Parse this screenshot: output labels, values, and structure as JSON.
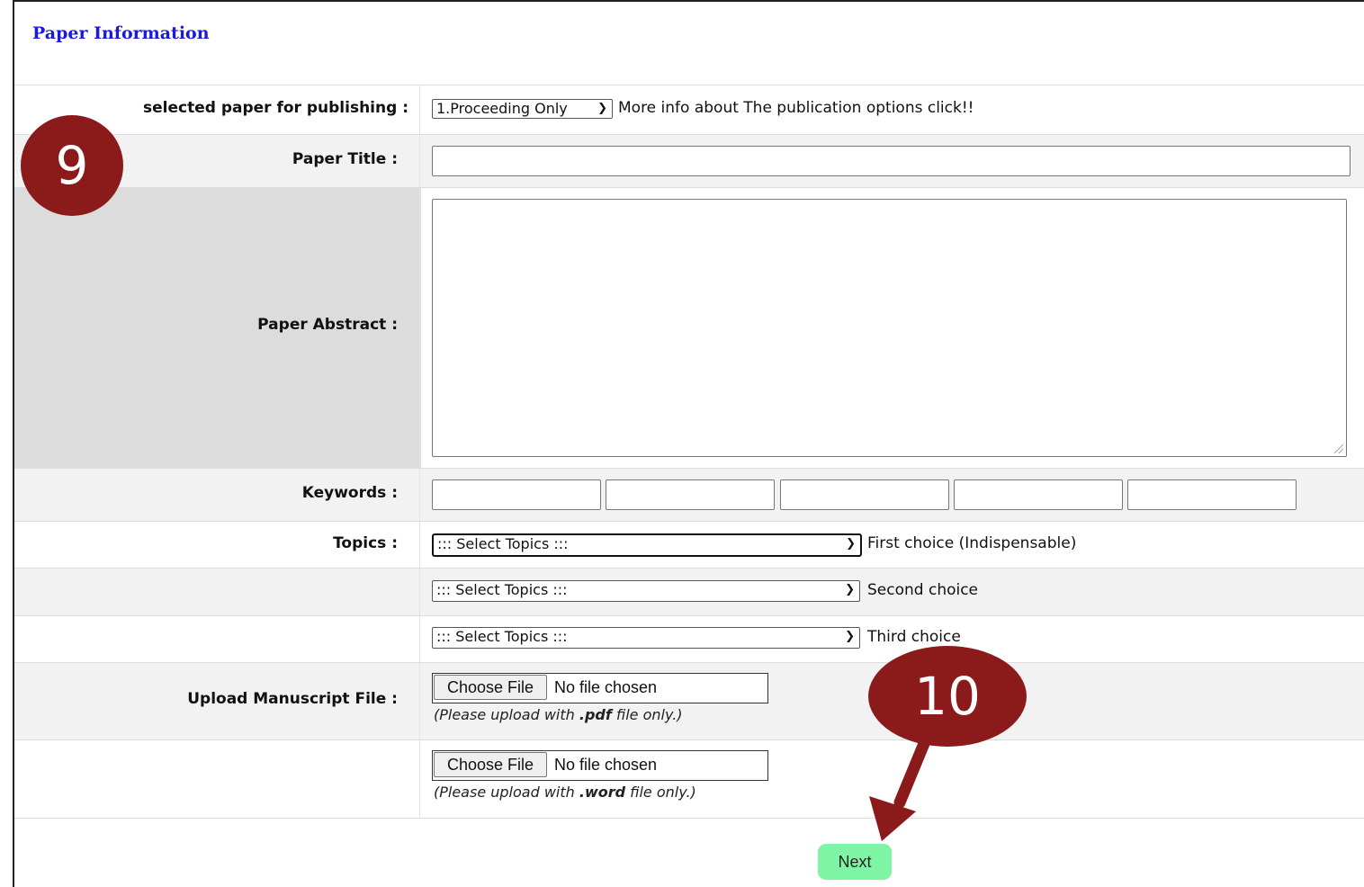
{
  "header": {
    "title": "Paper Information"
  },
  "form": {
    "publishing": {
      "label": "selected paper for publishing :",
      "selected": "1.Proceeding Only",
      "info_text": "More info about The publication options click!!"
    },
    "title": {
      "label": "Paper Title :",
      "value": ""
    },
    "abstract": {
      "label": "Paper Abstract :",
      "value": ""
    },
    "keywords": {
      "label": "Keywords :",
      "values": [
        "",
        "",
        "",
        "",
        ""
      ]
    },
    "topics": {
      "label": "Topics :",
      "choices": [
        {
          "selected": "::: Select Topics :::",
          "note": "First choice (Indispensable)"
        },
        {
          "selected": "::: Select Topics :::",
          "note": "Second choice"
        },
        {
          "selected": "::: Select Topics :::",
          "note": "Third choice"
        }
      ]
    },
    "upload": {
      "label": "Upload Manuscript File :",
      "files": [
        {
          "button": "Choose File",
          "status": "No file chosen",
          "hint_prefix": "(Please upload with ",
          "hint_ext": ".pdf",
          "hint_suffix": " file only.)"
        },
        {
          "button": "Choose File",
          "status": "No file chosen",
          "hint_prefix": "(Please upload with ",
          "hint_ext": ".word",
          "hint_suffix": " file only.)"
        }
      ]
    },
    "next_label": "Next"
  },
  "annotations": {
    "step_a": "9",
    "step_b": "10",
    "color": "#8b1a1a"
  },
  "colors": {
    "header": "#1a1adb",
    "next_button": "#7ef5a5",
    "row_alt": "#f2f2f2",
    "row_grey": "#dcdcdc"
  }
}
